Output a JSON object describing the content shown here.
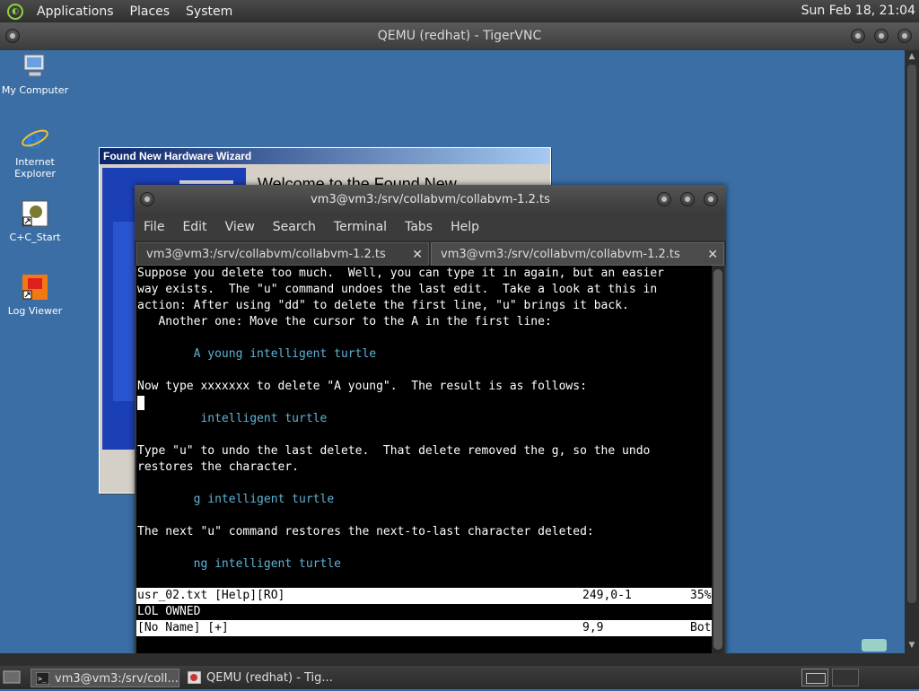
{
  "top_panel": {
    "menus": [
      "Applications",
      "Places",
      "System"
    ],
    "clock": "Sun Feb 18, 21:04"
  },
  "vnc_window": {
    "title": "QEMU (redhat) - TigerVNC"
  },
  "desktop_icons": [
    {
      "label_line1": "My Computer",
      "label_line2": ""
    },
    {
      "label_line1": "Internet",
      "label_line2": "Explorer"
    },
    {
      "label_line1": "C+C_Start",
      "label_line2": ""
    },
    {
      "label_line1": "Log Viewer",
      "label_line2": ""
    }
  ],
  "wizard": {
    "title": "Found New Hardware Wizard",
    "heading": "Welcome to the Found New"
  },
  "terminal": {
    "title": "vm3@vm3:/srv/collabvm/collabvm-1.2.ts",
    "menu": [
      "File",
      "Edit",
      "View",
      "Search",
      "Terminal",
      "Tabs",
      "Help"
    ],
    "tabs": [
      {
        "label": "vm3@vm3:/srv/collabvm/collabvm-1.2.ts",
        "close": "✕"
      },
      {
        "label": "vm3@vm3:/srv/collabvm/collabvm-1.2.ts",
        "close": "✕"
      }
    ],
    "lines": [
      {
        "text": "Suppose you delete too much.  Well, you can type it in again, but an easier",
        "style": "normal"
      },
      {
        "text": "way exists.  The \"u\" command undoes the last edit.  Take a look at this in",
        "style": "normal"
      },
      {
        "text": "action: After using \"dd\" to delete the first line, \"u\" brings it back.",
        "style": "normal"
      },
      {
        "text": "   Another one: Move the cursor to the A in the first line:",
        "style": "normal"
      },
      {
        "text": "",
        "style": "normal"
      },
      {
        "text": "        A young intelligent turtle",
        "style": "cyan"
      },
      {
        "text": "",
        "style": "normal"
      },
      {
        "text": "Now type xxxxxxx to delete \"A young\".  The result is as follows:",
        "style": "normal"
      },
      {
        "text": "",
        "style": "cursor"
      },
      {
        "text": "         intelligent turtle",
        "style": "cyan"
      },
      {
        "text": "",
        "style": "normal"
      },
      {
        "text": "Type \"u\" to undo the last delete.  That delete removed the g, so the undo",
        "style": "normal"
      },
      {
        "text": "restores the character.",
        "style": "normal"
      },
      {
        "text": "",
        "style": "normal"
      },
      {
        "text": "        g intelligent turtle",
        "style": "cyan"
      },
      {
        "text": "",
        "style": "normal"
      },
      {
        "text": "The next \"u\" command restores the next-to-last character deleted:",
        "style": "normal"
      },
      {
        "text": "",
        "style": "normal"
      },
      {
        "text": "        ng intelligent turtle",
        "style": "cyan"
      }
    ],
    "status1": {
      "file": "usr_02.txt [Help][RO]",
      "pos": "249,0-1",
      "pct": "35%"
    },
    "message": "LOL OWNED",
    "status2": {
      "file": "[No Name] [+]",
      "pos": "9,9",
      "pct": "Bot"
    }
  },
  "taskbar": {
    "tasks": [
      "vm3@vm3:/srv/coll...",
      "QEMU (redhat) - Tig..."
    ]
  }
}
